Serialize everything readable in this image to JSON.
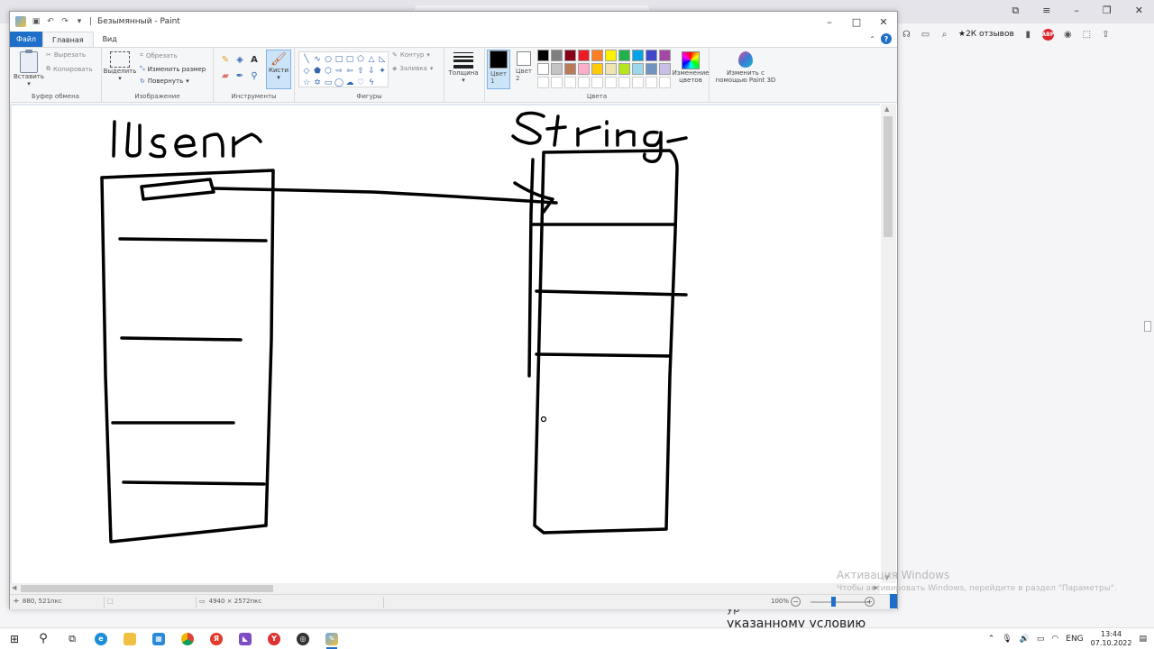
{
  "paint": {
    "title": "Безымянный - Paint",
    "menu": {
      "file": "Файл",
      "tabs": [
        "Главная",
        "Вид"
      ]
    },
    "ribbon": {
      "clipboard": {
        "paste": "Вставить",
        "cut": "Вырезать",
        "copy": "Копировать",
        "label": "Буфер обмена"
      },
      "image": {
        "select": "Выделить",
        "crop": "Обрезать",
        "resize": "Изменить размер",
        "rotate": "Повернуть",
        "label": "Изображение"
      },
      "tools": {
        "brushes": "Кисти",
        "label": "Инструменты"
      },
      "shapes": {
        "outline": "Контур",
        "fill": "Заливка",
        "label": "Фигуры"
      },
      "size": {
        "label": "Толщина"
      },
      "colors": {
        "color1_label": "Цвет\n1",
        "color2_label": "Цвет\n2",
        "color1": "#000000",
        "color2": "#ffffff",
        "edit_colors": "Изменение цветов",
        "label": "Цвета",
        "palette_row1": [
          "#000000",
          "#7f7f7f",
          "#880015",
          "#ed1c24",
          "#ff7f27",
          "#fff200",
          "#22b14c",
          "#00a2e8",
          "#3f48cc",
          "#a349a4"
        ],
        "palette_row2": [
          "#ffffff",
          "#c3c3c3",
          "#b97a57",
          "#ffaec9",
          "#ffc90e",
          "#efe4b0",
          "#b5e61d",
          "#99d9ea",
          "#7092be",
          "#c8bfe7"
        ],
        "palette_row3": [
          "#ffffff",
          "#ffffff",
          "#ffffff",
          "#ffffff",
          "#ffffff",
          "#ffffff",
          "#ffffff",
          "#ffffff",
          "#ffffff",
          "#ffffff"
        ]
      },
      "paint3d": "Изменить с помощью Paint 3D"
    },
    "status": {
      "cursor_position": "880, 521пкс",
      "image_size": "4940 × 2572пкс",
      "zoom": "100%"
    }
  },
  "canvas_drawing": {
    "labels": [
      "User",
      "String"
    ]
  },
  "background_browser": {
    "star_count": "★2К отзывов",
    "text_top": "ур",
    "text_bottom": "указанному условию"
  },
  "watermark": {
    "title": "Активация Windows",
    "subtitle": "Чтобы активировать Windows, перейдите в раздел \"Параметры\"."
  },
  "taskbar": {
    "language": "ENG",
    "time": "13:44",
    "date": "07.10.2022"
  }
}
